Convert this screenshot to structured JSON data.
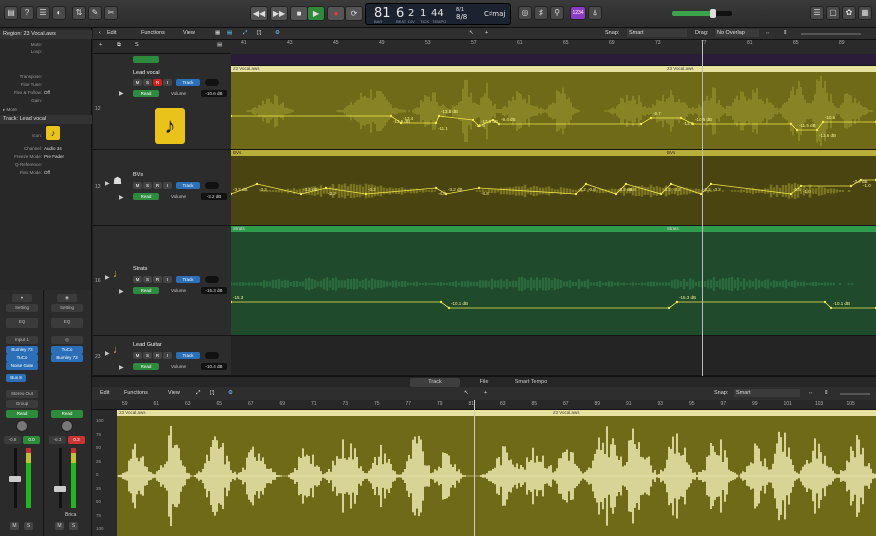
{
  "transport": {
    "lcd_bar": "81",
    "lcd_beat": "6",
    "lcd_div": "2",
    "lcd_tick": "1",
    "lcd_tempo": "44",
    "lcd_sig_top": "8/1",
    "lcd_sig": "8/8",
    "lcd_key": "C♯maj",
    "lcd_labels": [
      "BAR",
      "BEAT",
      "DIV",
      "TICK",
      "TEMPO"
    ],
    "badge": "1234"
  },
  "inspector": {
    "region_header": "Region: 23 Vocal.aws",
    "region_rows": [
      {
        "k": "Mute:",
        "v": ""
      },
      {
        "k": "Loop:",
        "v": ""
      },
      {
        "k": "Transpose:",
        "v": ""
      },
      {
        "k": "Fine Tune:",
        "v": ""
      },
      {
        "k": "Flex & Follow:",
        "v": "Off"
      },
      {
        "k": "Gain:",
        "v": ""
      }
    ],
    "more": "More",
    "track_header": "Track:  Lead vocal",
    "track_rows": [
      {
        "k": "Channel:",
        "v": "Audio 34"
      },
      {
        "k": "Freeze Mode:",
        "v": "Pre Fader"
      },
      {
        "k": "Q-Reference:",
        "v": ""
      },
      {
        "k": "Flex Mode:",
        "v": "Off"
      }
    ],
    "icon_label": "Icon:"
  },
  "strips": [
    {
      "setting": "Setting",
      "eq": "EQ",
      "input": "Input 1",
      "plugins": [
        "Bumley 73",
        "TuCo",
        "Noise Gate"
      ],
      "bus": "Bus 8",
      "output": "Stereo Out",
      "group": "Group",
      "auto": "Read",
      "pan": "-0.8",
      "vol": "0.0",
      "mute": "M",
      "solo": "S",
      "name": ""
    },
    {
      "setting": "Setting",
      "eq": "EQ",
      "input": "",
      "plugins": [
        "TuCo",
        "Bumley 73"
      ],
      "bus": "",
      "output": "",
      "group": "",
      "auto": "Read",
      "pan": "-6.3",
      "vol": "0.3",
      "mute": "M",
      "solo": "S",
      "name": "Brica"
    }
  ],
  "tracks_toolbar": {
    "edit": "Edit",
    "functions": "Functions",
    "view": "View",
    "snap_label": "Snap:",
    "snap_value": "Smart",
    "drag_label": "Drag:",
    "drag_value": "No Overlap"
  },
  "ruler_top": [
    "41",
    "43",
    "45",
    "49",
    "53",
    "57",
    "61",
    "65",
    "69",
    "73",
    "77",
    "81",
    "85",
    "89",
    "93"
  ],
  "tracks": [
    {
      "num": "12",
      "name": "Lead vocal",
      "auto": "Read",
      "vol_label": "Volume",
      "vol": "-10.6 dB",
      "region": "23 Vocal.aws",
      "region2": "23 Vocal.aws"
    },
    {
      "num": "13",
      "name": "BVs",
      "auto": "Read",
      "vol_label": "Volume",
      "vol": "-3.2 dB",
      "region": "BVs",
      "region2": "BVs"
    },
    {
      "num": "16",
      "name": "Strats",
      "auto": "Read",
      "vol_label": "Volume",
      "vol": "-15.3 dB",
      "region": "Strats",
      "region2": "Strats"
    },
    {
      "num": "23",
      "name": "Lead Guitar",
      "auto": "Read",
      "vol_label": "Volume",
      "vol": "-10.4 dB",
      "region": "",
      "region2": ""
    }
  ],
  "track_buttons": {
    "m": "M",
    "s": "S",
    "r": "R",
    "i": "I",
    "track": "Track"
  },
  "automation_labels": {
    "lead": [
      "-13.5 dB",
      "-13.4",
      "-11.1",
      "-13.5 dB",
      "-11.6",
      "-9.4 dB",
      "-9.7",
      "-13.8",
      "-10.5 dB",
      "-11.5 dB",
      "-13.6 dB",
      "-10.6"
    ],
    "bvs": [
      "-3.2 dB",
      "-3.2",
      "-3.2 dB",
      "-3.2",
      "-3.2",
      "-4.8",
      "-3.2 dB",
      "-4.8",
      "-3.2",
      "-0.8",
      "-3.2 dB",
      "-0.8",
      "-3.2",
      "-3.2",
      "-3.2",
      "-3.2",
      "-6.5",
      "-1.0",
      "-3.2 dB",
      "-1.0",
      "-3.2"
    ],
    "strats": [
      "-15.3",
      "-10.1 dB",
      "-15.3 dB",
      "-10.1 dB"
    ]
  },
  "editor": {
    "tabs": [
      "Track",
      "File",
      "Smart Tempo"
    ],
    "edit": "Edit",
    "functions": "Functions",
    "view": "View",
    "snap_label": "Snap:",
    "snap_value": "Smart",
    "ruler": [
      "59",
      "61",
      "63",
      "65",
      "67",
      "69",
      "71",
      "73",
      "75",
      "77",
      "79",
      "81",
      "83",
      "85",
      "87",
      "89",
      "91",
      "93",
      "95",
      "97",
      "99",
      "101",
      "103",
      "105",
      "107"
    ],
    "region_name": "23 Vocal.aws",
    "region_name2": "23 Vocal.aws",
    "ylabels": [
      "100",
      "75",
      "50",
      "25",
      "0",
      "25",
      "50",
      "75",
      "100"
    ]
  },
  "colors": {
    "lead_region": "#6e6a18",
    "lead_hdr": "#e8e2a0",
    "bvs_region": "#4a4510",
    "bvs_hdr": "#b8ae3a",
    "strats_region": "#1f4a2c",
    "strats_hdr": "#2e9c4c",
    "editor_wave": "#f2eeb6",
    "automation": "#f2e84a"
  }
}
